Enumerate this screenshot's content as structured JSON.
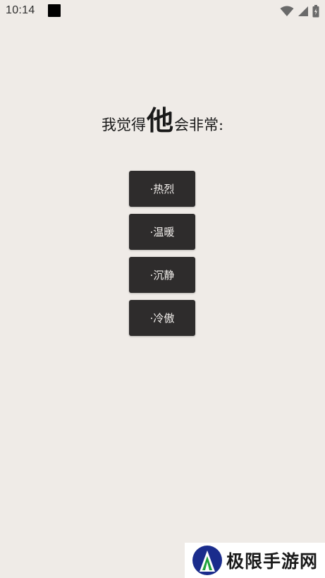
{
  "status_bar": {
    "time": "10:14",
    "icons": [
      "wifi-icon",
      "signal-icon",
      "battery-icon"
    ]
  },
  "question": {
    "prefix": "我觉得",
    "emphasis": "他",
    "suffix": "会非常:"
  },
  "options": [
    {
      "label": "·热烈"
    },
    {
      "label": "·温暖"
    },
    {
      "label": "·沉静"
    },
    {
      "label": "·冷傲"
    }
  ],
  "watermark": {
    "text": "极限手游网"
  },
  "colors": {
    "background": "#efebe7",
    "button": "#2e2c2c",
    "button_text": "#f4f1ee",
    "logo_blue": "#1a2c8c",
    "logo_green": "#1fa33a"
  }
}
